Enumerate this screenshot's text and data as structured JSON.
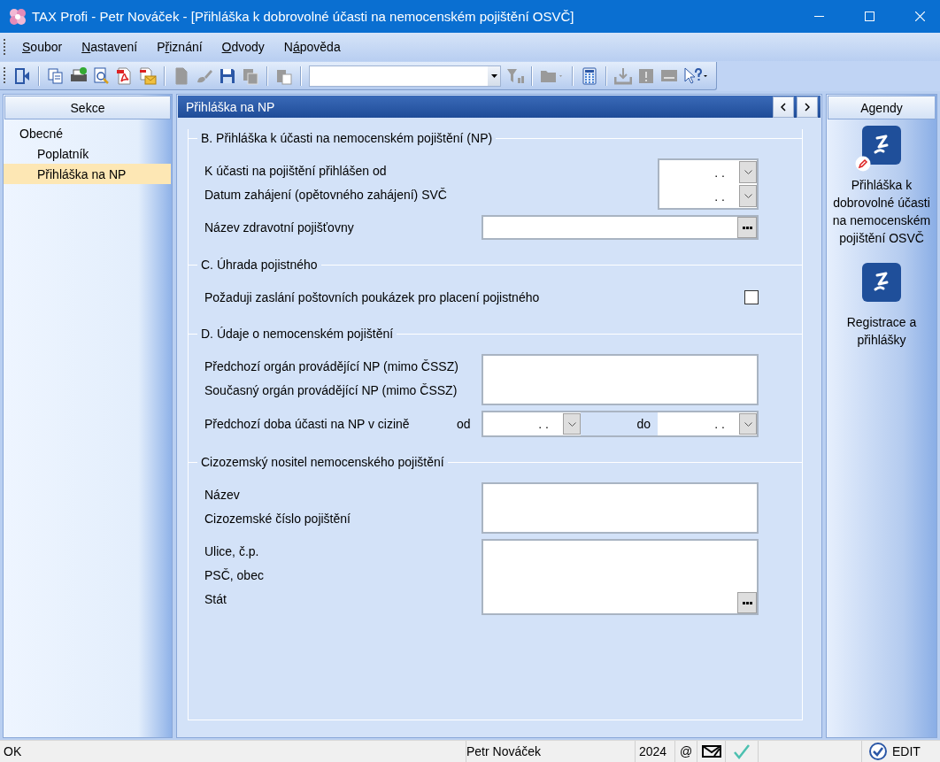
{
  "window": {
    "title": "TAX Profi - Petr Nováček - [Přihláška k dobrovolné účasti na nemocenském pojištění OSVČ]"
  },
  "menu": [
    {
      "key": "S",
      "post": "oubor"
    },
    {
      "key": "N",
      "post": "astavení"
    },
    {
      "pre": "P",
      "key": "ř",
      "post": "iznání"
    },
    {
      "key": "O",
      "post": "dvody"
    },
    {
      "pre": "N",
      "key": "á",
      "post": "pověda"
    }
  ],
  "toolbar": [
    {
      "kind": "exit",
      "disabled": false
    },
    {
      "kind": "separator"
    },
    {
      "kind": "copy",
      "disabled": false
    },
    {
      "kind": "print",
      "disabled": false
    },
    {
      "kind": "preview",
      "disabled": false
    },
    {
      "kind": "pdf",
      "disabled": false
    },
    {
      "kind": "pdf-mail",
      "disabled": false
    },
    {
      "kind": "separator"
    },
    {
      "kind": "new",
      "disabled": true
    },
    {
      "kind": "brush",
      "disabled": true
    },
    {
      "kind": "save",
      "disabled": false
    },
    {
      "kind": "duplicate",
      "disabled": true
    },
    {
      "kind": "separator"
    },
    {
      "kind": "paste",
      "disabled": true
    },
    {
      "kind": "separator"
    },
    {
      "kind": "combo"
    },
    {
      "kind": "filter",
      "disabled": true
    },
    {
      "kind": "separator"
    },
    {
      "kind": "folder",
      "disabled": true
    },
    {
      "kind": "separator"
    },
    {
      "kind": "calculator",
      "disabled": false
    },
    {
      "kind": "separator"
    },
    {
      "kind": "import",
      "disabled": true
    },
    {
      "kind": "exclaim",
      "disabled": true
    },
    {
      "kind": "screen",
      "disabled": true
    },
    {
      "kind": "help",
      "disabled": false
    }
  ],
  "sidebar": {
    "title": "Sekce",
    "items": [
      {
        "label": "Obecné",
        "selected": false,
        "children": [
          {
            "label": "Poplatník",
            "selected": false
          },
          {
            "label": "Přihláška na NP",
            "selected": true
          }
        ]
      }
    ]
  },
  "form": {
    "title": "Přihláška na NP",
    "sections": [
      {
        "title": "B. Přihláška k účasti na nemocenském pojištění (NP)",
        "fields": [
          {
            "kind": "date-pair",
            "labels": [
              "K účasti na pojištění přihlášen od",
              "Datum zahájení (opětovného zahájení) SVČ"
            ],
            "values": [
              ". .",
              ". ."
            ]
          },
          {
            "kind": "lookup",
            "labels": [
              "Název zdravotní pojišťovny"
            ]
          }
        ]
      },
      {
        "title": "C. Úhrada pojistného",
        "fields": [
          {
            "kind": "checkbox",
            "labels": [
              "Požaduji zaslání poštovních poukázek pro placení pojistného"
            ],
            "checked": false
          }
        ]
      },
      {
        "title": "D. Údaje o nemocenském pojištění",
        "fields": [
          {
            "kind": "textarea",
            "labels": [
              "Předchozí orgán provádějící NP (mimo ČSSZ)",
              "Současný orgán provádějící NP (mimo ČSSZ)"
            ]
          },
          {
            "kind": "range",
            "labels": [
              "Předchozí doba účasti na NP v cizině"
            ],
            "from_label": "od",
            "from_value": ". .",
            "to_label": "do",
            "to_value": ". ."
          }
        ]
      },
      {
        "title": "Cizozemský nositel nemocenského pojištění",
        "fields": [
          {
            "kind": "textarea",
            "labels": [
              "Název",
              "Cizozemské číslo pojištění"
            ]
          },
          {
            "kind": "address",
            "labels": [
              "Ulice, č.p.",
              "PSČ, obec",
              "Stát"
            ]
          }
        ]
      }
    ]
  },
  "agendy": {
    "title": "Agendy",
    "items": [
      {
        "label": "Přihláška k dobrovolné účasti na nemocenském pojištění OSVČ",
        "active": true
      },
      {
        "label": "Registrace a přihlášky",
        "active": false
      }
    ]
  },
  "status_bar": {
    "message": "OK",
    "user": "Petr Nováček",
    "year": "2024",
    "at": "@",
    "mode": "EDIT"
  }
}
